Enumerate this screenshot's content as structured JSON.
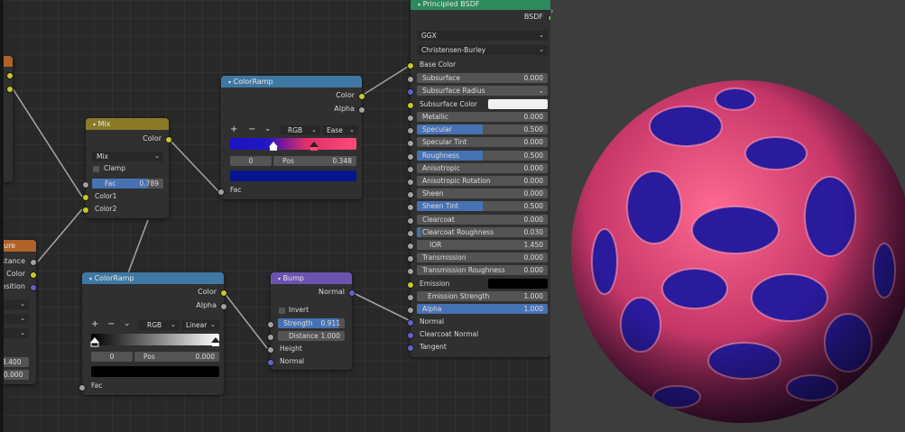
{
  "mix_node": {
    "title": "Mix",
    "output_color": "Color",
    "blend_mode": "Mix",
    "clamp_label": "Clamp",
    "fac_label": "Fac",
    "fac_value": "0.789",
    "fac_fraction": 0.789,
    "color1_label": "Color1",
    "color2_label": "Color2"
  },
  "ramp_top": {
    "title": "ColorRamp",
    "out_color": "Color",
    "out_alpha": "Alpha",
    "add": "+",
    "remove": "−",
    "menu": "⌄",
    "color_mode": "RGB",
    "interpolation": "Ease",
    "stop_index": "0",
    "pos_label": "Pos",
    "pos_value": "0.348",
    "fac_label": "Fac"
  },
  "ramp_bottom": {
    "title": "ColorRamp",
    "out_color": "Color",
    "out_alpha": "Alpha",
    "add": "+",
    "remove": "−",
    "menu": "⌄",
    "color_mode": "RGB",
    "interpolation": "Linear",
    "stop_index": "0",
    "pos_label": "Pos",
    "pos_value": "0.000",
    "fac_label": "Fac"
  },
  "bump_node": {
    "title": "Bump",
    "out_normal": "Normal",
    "invert_label": "Invert",
    "strength_label": "Strength",
    "strength_value": "0.911",
    "strength_fraction": 0.911,
    "distance_label": "Distance",
    "distance_value": "1.000",
    "height_label": "Height",
    "normal_label": "Normal"
  },
  "texture_node": {
    "title": "ure",
    "outputs": [
      "stance",
      "Color",
      "osition"
    ],
    "value1": "3.400",
    "value2": "0.000"
  },
  "bsdf": {
    "title": "Principled BSDF",
    "output": "BSDF",
    "distribution": "GGX",
    "subsurface_method": "Christensen-Burley",
    "base_color_label": "Base Color",
    "subsurface_color_label": "Subsurface Color",
    "emission_label": "Emission",
    "inputs_top": [
      {
        "label": "Subsurface",
        "value": "0.000",
        "fill": 0
      },
      {
        "label": "Subsurface Radius",
        "value": "",
        "fill": 0
      }
    ],
    "inputs_mid": [
      {
        "label": "Metallic",
        "value": "0.000",
        "fill": 0
      },
      {
        "label": "Specular",
        "value": "0.500",
        "fill": 0.5
      },
      {
        "label": "Specular Tint",
        "value": "0.000",
        "fill": 0
      },
      {
        "label": "Roughness",
        "value": "0.500",
        "fill": 0.5
      },
      {
        "label": "Anisotropic",
        "value": "0.000",
        "fill": 0
      },
      {
        "label": "Anisotropic Rotation",
        "value": "0.000",
        "fill": 0
      },
      {
        "label": "Sheen",
        "value": "0.000",
        "fill": 0
      },
      {
        "label": "Sheen Tint",
        "value": "0.500",
        "fill": 0.5
      },
      {
        "label": "Clearcoat",
        "value": "0.000",
        "fill": 0
      },
      {
        "label": "Clearcoat Roughness",
        "value": "0.030",
        "fill": 0.03
      },
      {
        "label": "IOR",
        "value": "1.450",
        "fill": 0
      },
      {
        "label": "Transmission",
        "value": "0.000",
        "fill": 0
      },
      {
        "label": "Transmission Roughness",
        "value": "0.000",
        "fill": 0
      }
    ],
    "emission_strength_label": "Emission Strength",
    "emission_strength_value": "1.000",
    "alpha_label": "Alpha",
    "alpha_value": "1.000",
    "normal_label": "Normal",
    "clearcoat_normal_label": "Clearcoat Normal",
    "tangent_label": "Tangent"
  },
  "colors": {
    "socket_color": "#c7c729",
    "socket_float": "#a1a1a1",
    "socket_vector": "#6363c7",
    "slider_blue": "#4772b3",
    "ramp_dark_blue": "#06148f"
  }
}
